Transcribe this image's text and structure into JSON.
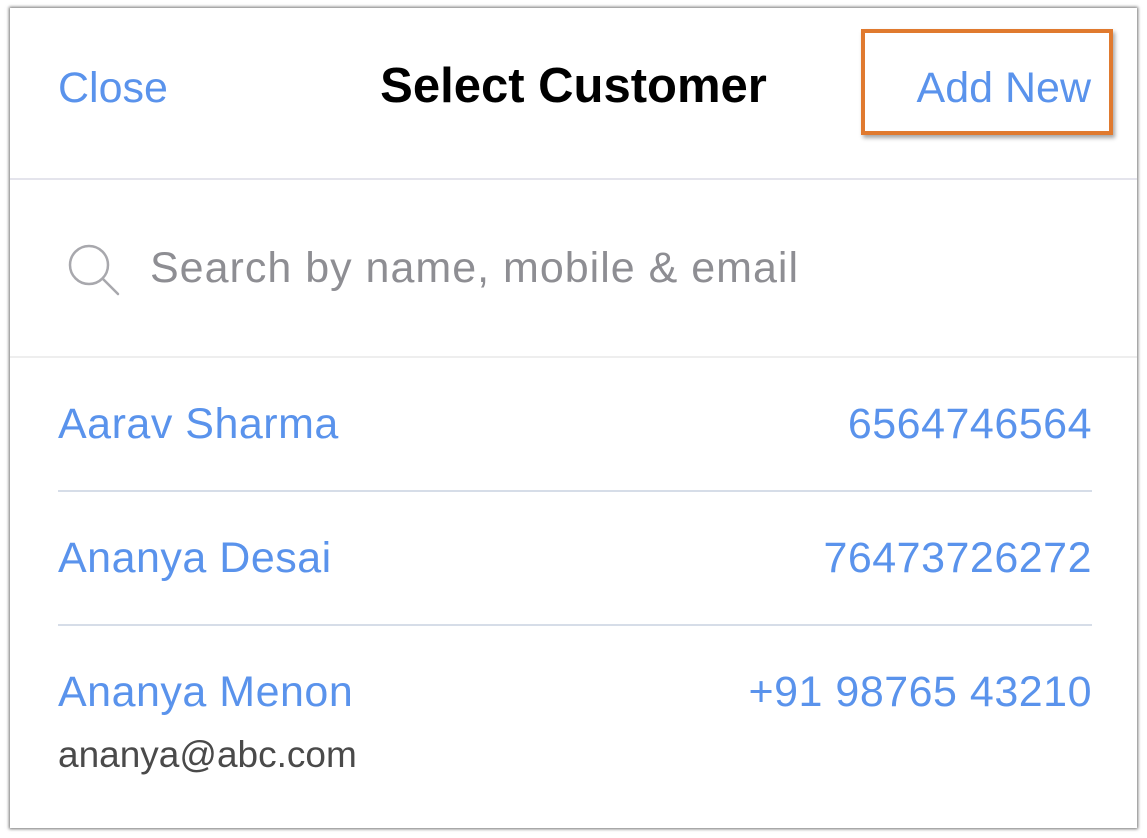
{
  "header": {
    "close_label": "Close",
    "title": "Select Customer",
    "add_new_label": "Add New"
  },
  "search": {
    "placeholder": "Search by name, mobile & email",
    "value": ""
  },
  "customers": [
    {
      "name": "Aarav Sharma",
      "phone": "6564746564",
      "email": ""
    },
    {
      "name": "Ananya Desai",
      "phone": "76473726272",
      "email": ""
    },
    {
      "name": "Ananya Menon",
      "phone": "+91 98765 43210",
      "email": "ananya@abc.com"
    }
  ],
  "colors": {
    "accent": "#5a93ec",
    "highlight_border": "#e07a2f",
    "title": "#000000",
    "email_text": "#4a4a4a",
    "placeholder": "#8e8e93"
  },
  "icons": {
    "search": "search-icon"
  }
}
